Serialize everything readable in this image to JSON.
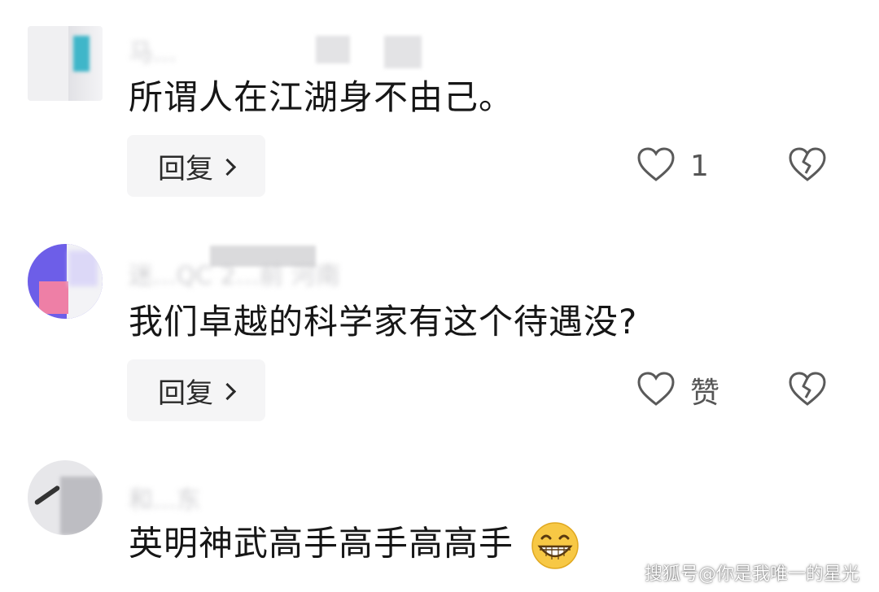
{
  "comments": [
    {
      "author_meta": "马...",
      "text": "所谓人在江湖身不由己。",
      "reply_label": "回复",
      "like_label": "1"
    },
    {
      "author_meta": "迷...QC 2...前 河南",
      "text": "我们卓越的科学家有这个待遇没?",
      "reply_label": "回复",
      "like_label": "赞"
    },
    {
      "author_meta": "和...东",
      "text": "英明神武高手高手高高手",
      "emoji": "😁"
    }
  ],
  "watermark": "搜狐号@你是我唯一的星光",
  "icons": {
    "like": "heart-outline-icon",
    "dislike": "broken-heart-icon",
    "reply": "chevron-right-icon",
    "emoji": "grinning-face-icon"
  }
}
